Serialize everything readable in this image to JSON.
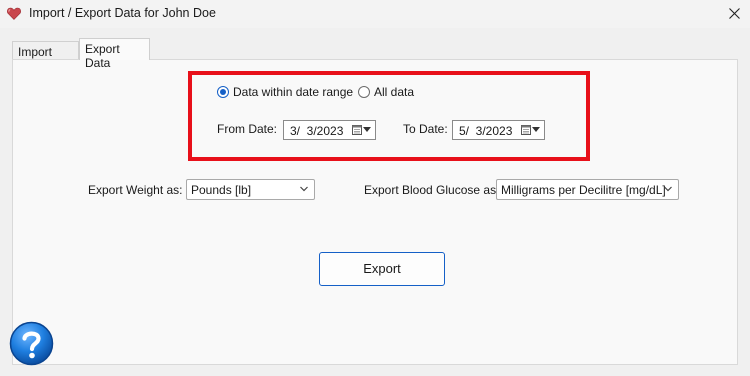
{
  "window": {
    "title": "Import / Export Data for John Doe"
  },
  "tabs": [
    {
      "label": "Import Data",
      "active": false
    },
    {
      "label": "Export Data",
      "active": true
    }
  ],
  "range": {
    "options": [
      {
        "label": "Data within date range",
        "checked": true
      },
      {
        "label": "All data",
        "checked": false
      }
    ],
    "from_label": "From Date:",
    "from_value": "3/  3/2023",
    "to_label": "To Date:",
    "to_value": "5/  3/2023"
  },
  "export_weight": {
    "label": "Export Weight as:",
    "value": "Pounds [lb]"
  },
  "export_glucose": {
    "label": "Export Blood Glucose as:",
    "value": "Milligrams per Decilitre [mg/dL]"
  },
  "export_button": {
    "label": "Export"
  },
  "colors": {
    "accent": "#1560c7",
    "highlight": "#e8101a",
    "help": "#1f7fe0"
  },
  "icons": [
    "heart-icon",
    "close-icon",
    "calendar-icon",
    "chevron-down-icon",
    "help-icon"
  ]
}
